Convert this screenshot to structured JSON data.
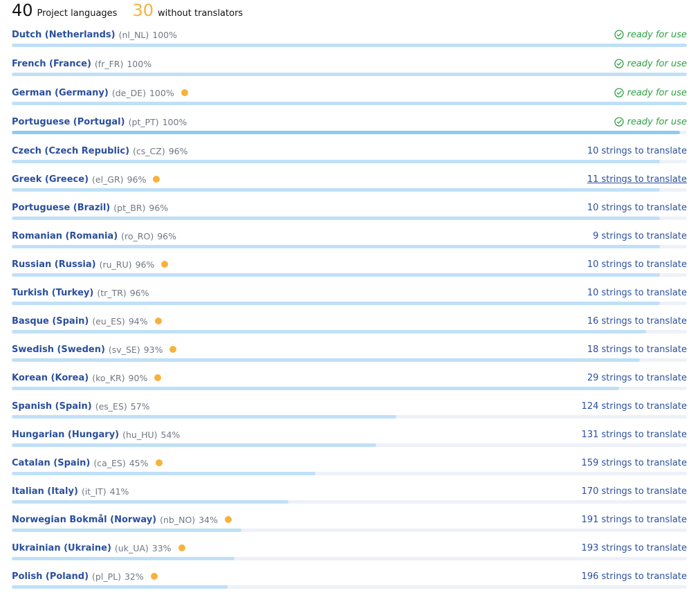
{
  "summary": {
    "total_count": "40",
    "total_label": "Project languages",
    "missing_count": "30",
    "missing_label": "without translators"
  },
  "colors": {
    "accent": "#2a4f9d",
    "ready": "#2ea043",
    "warning_dot": "#f6b23d",
    "bar_fill": "#bfe0f7",
    "bar_track": "#eef1f8"
  },
  "icons": {
    "ready": "check-circle-icon"
  },
  "languages": [
    {
      "name": "Dutch (Netherlands)",
      "code": "(nl_NL)",
      "percent": "100%",
      "progress": 100,
      "dot": false,
      "status": "ready for use",
      "ready": true
    },
    {
      "name": "French (France)",
      "code": "(fr_FR)",
      "percent": "100%",
      "progress": 100,
      "dot": false,
      "status": "ready for use",
      "ready": true
    },
    {
      "name": "German (Germany)",
      "code": "(de_DE)",
      "percent": "100%",
      "progress": 100,
      "dot": true,
      "status": "ready for use",
      "ready": true
    },
    {
      "name": "Portuguese (Portugal)",
      "code": "(pt_PT)",
      "percent": "100%",
      "progress": 99,
      "dot": false,
      "status": "ready for use",
      "ready": true,
      "highlighted": true
    },
    {
      "name": "Czech (Czech Republic)",
      "code": "(cs_CZ)",
      "percent": "96%",
      "progress": 96,
      "dot": false,
      "status": "10 strings to translate",
      "ready": false
    },
    {
      "name": "Greek (Greece)",
      "code": "(el_GR)",
      "percent": "96%",
      "progress": 96,
      "dot": true,
      "status": "11 strings to translate",
      "ready": false,
      "underlined": true
    },
    {
      "name": "Portuguese (Brazil)",
      "code": "(pt_BR)",
      "percent": "96%",
      "progress": 96,
      "dot": false,
      "status": "10 strings to translate",
      "ready": false
    },
    {
      "name": "Romanian (Romania)",
      "code": "(ro_RO)",
      "percent": "96%",
      "progress": 96,
      "dot": false,
      "status": "9 strings to translate",
      "ready": false
    },
    {
      "name": "Russian (Russia)",
      "code": "(ru_RU)",
      "percent": "96%",
      "progress": 96,
      "dot": true,
      "status": "10 strings to translate",
      "ready": false
    },
    {
      "name": "Turkish (Turkey)",
      "code": "(tr_TR)",
      "percent": "96%",
      "progress": 96,
      "dot": false,
      "status": "10 strings to translate",
      "ready": false
    },
    {
      "name": "Basque (Spain)",
      "code": "(eu_ES)",
      "percent": "94%",
      "progress": 94,
      "dot": true,
      "status": "16 strings to translate",
      "ready": false
    },
    {
      "name": "Swedish (Sweden)",
      "code": "(sv_SE)",
      "percent": "93%",
      "progress": 93,
      "dot": true,
      "status": "18 strings to translate",
      "ready": false
    },
    {
      "name": "Korean (Korea)",
      "code": "(ko_KR)",
      "percent": "90%",
      "progress": 90,
      "dot": true,
      "status": "29 strings to translate",
      "ready": false
    },
    {
      "name": "Spanish (Spain)",
      "code": "(es_ES)",
      "percent": "57%",
      "progress": 57,
      "dot": false,
      "status": "124 strings to translate",
      "ready": false
    },
    {
      "name": "Hungarian (Hungary)",
      "code": "(hu_HU)",
      "percent": "54%",
      "progress": 54,
      "dot": false,
      "status": "131 strings to translate",
      "ready": false
    },
    {
      "name": "Catalan (Spain)",
      "code": "(ca_ES)",
      "percent": "45%",
      "progress": 45,
      "dot": true,
      "status": "159 strings to translate",
      "ready": false
    },
    {
      "name": "Italian (Italy)",
      "code": "(it_IT)",
      "percent": "41%",
      "progress": 41,
      "dot": false,
      "status": "170 strings to translate",
      "ready": false
    },
    {
      "name": "Norwegian Bokmål (Norway)",
      "code": "(nb_NO)",
      "percent": "34%",
      "progress": 34,
      "dot": true,
      "status": "191 strings to translate",
      "ready": false
    },
    {
      "name": "Ukrainian (Ukraine)",
      "code": "(uk_UA)",
      "percent": "33%",
      "progress": 33,
      "dot": true,
      "status": "193 strings to translate",
      "ready": false
    },
    {
      "name": "Polish (Poland)",
      "code": "(pl_PL)",
      "percent": "32%",
      "progress": 32,
      "dot": true,
      "status": "196 strings to translate",
      "ready": false
    }
  ]
}
